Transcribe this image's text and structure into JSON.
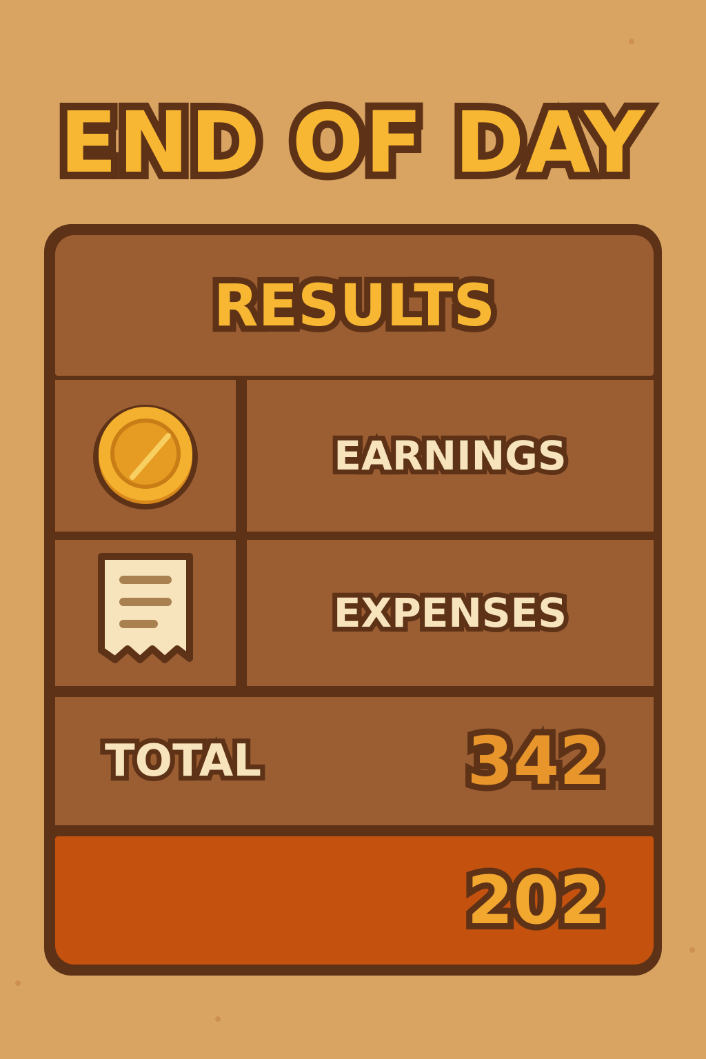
{
  "screen": {
    "title": "END OF DAY"
  },
  "results_panel": {
    "title": "RESULTS",
    "rows": [
      {
        "icon": "coin-icon",
        "label": "EARNINGS"
      },
      {
        "icon": "receipt-icon",
        "label": "EXPENSES"
      }
    ],
    "total": {
      "label": "TOTAL",
      "value": "342"
    },
    "final": {
      "value": "202"
    }
  },
  "colors": {
    "background": "#d9a462",
    "panel_border": "#5e3217",
    "panel_fill": "#9b5d32",
    "final_row_fill": "#c4520e",
    "title_gold": "#f7b733",
    "label_cream": "#f7e4bc",
    "value_orange": "#e8962c"
  }
}
